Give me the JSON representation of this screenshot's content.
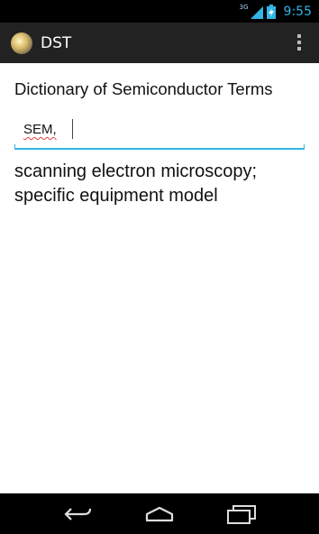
{
  "status_bar": {
    "network_type": "3G",
    "time": "9:55",
    "battery_icon": "battery-charging-icon"
  },
  "action_bar": {
    "title": "DST",
    "app_icon": "app-icon",
    "overflow_icon": "overflow-menu-icon"
  },
  "main": {
    "heading": "Dictionary of Semiconductor Terms",
    "search": {
      "value": "SEM,"
    },
    "result": "scanning electron microscopy; specific equipment model"
  },
  "nav_bar": {
    "back_icon": "back-icon",
    "home_icon": "home-icon",
    "recents_icon": "recent-apps-icon"
  },
  "colors": {
    "accent": "#33b5e5",
    "action_bar_bg": "#222222",
    "content_bg": "#ffffff"
  }
}
